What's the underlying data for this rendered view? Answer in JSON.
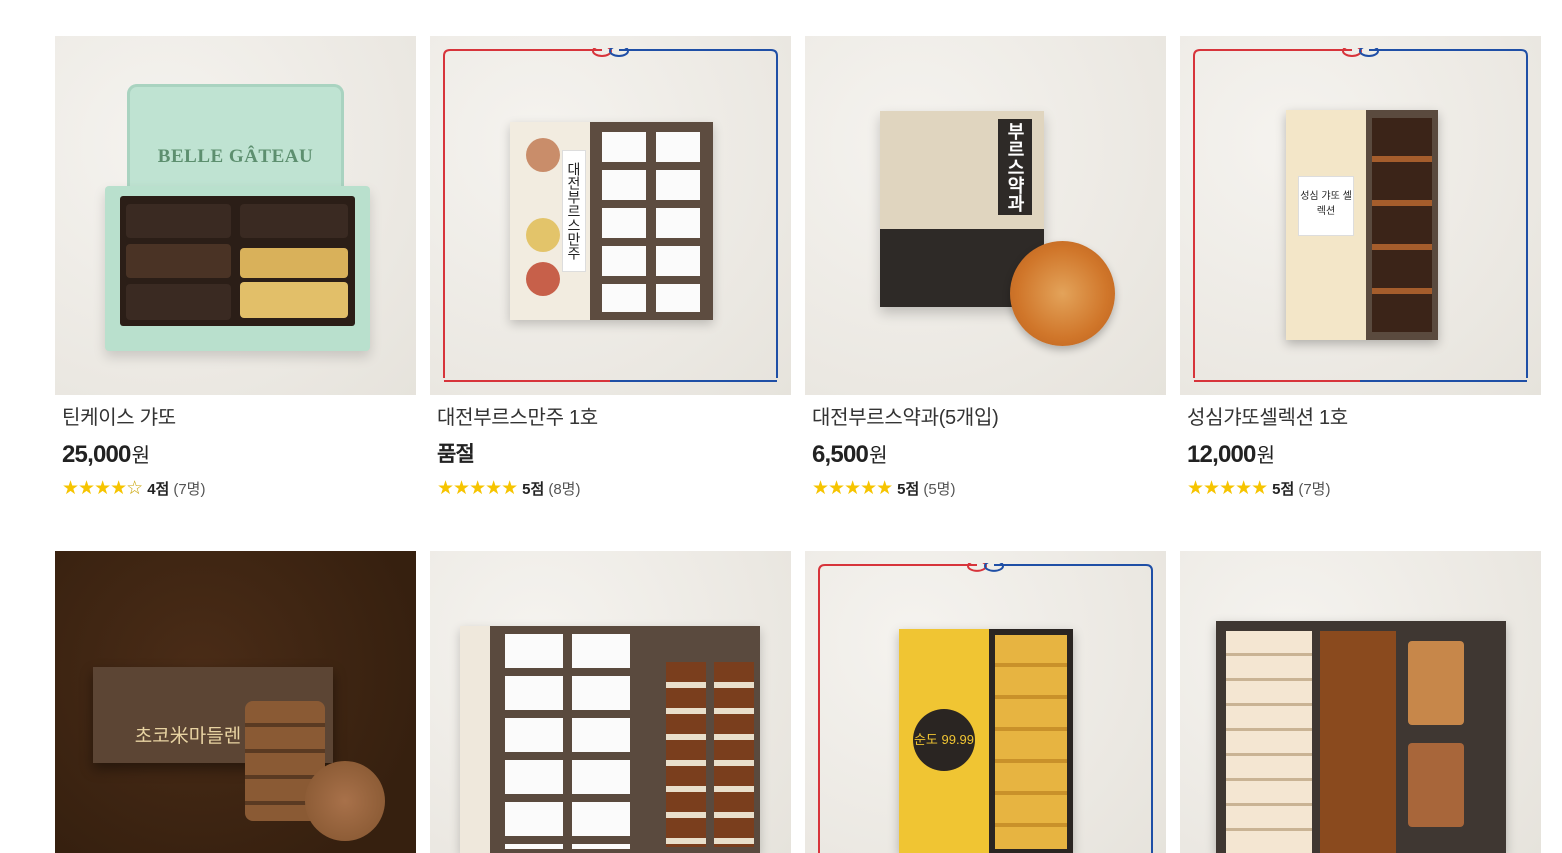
{
  "products": [
    {
      "name": "틴케이스 갸또",
      "price": "25,000",
      "currency": "원",
      "rating_stars": "★★★★",
      "rating_empty": "☆",
      "score": "4점",
      "reviews": "(7명)",
      "tin_title": "BELLE GÂTEAU"
    },
    {
      "name": "대전부르스만주 1호",
      "price_text": "품절",
      "rating_stars": "★★★★★",
      "score": "5점",
      "reviews": "(8명)",
      "box_label": "대전부르스만주"
    },
    {
      "name": "대전부르스약과(5개입)",
      "price": "6,500",
      "currency": "원",
      "rating_stars": "★★★★★",
      "score": "5점",
      "reviews": "(5명)",
      "box_label": "부르스약과"
    },
    {
      "name": "성심갸또셀렉션 1호",
      "price": "12,000",
      "currency": "원",
      "rating_stars": "★★★★★",
      "score": "5점",
      "reviews": "(7명)",
      "box_label": "성심 갸또 셀렉션"
    }
  ],
  "row2": [
    {
      "box_label": "초코米마들렌"
    },
    {},
    {
      "box_label": "순도 99.99"
    },
    {}
  ],
  "colors": {
    "star": "#f6c400",
    "frame_red": "#d7343b",
    "frame_blue": "#1f4fa6",
    "tin_mint": "#b9e0cd",
    "dark_bg": "#3b2313"
  }
}
